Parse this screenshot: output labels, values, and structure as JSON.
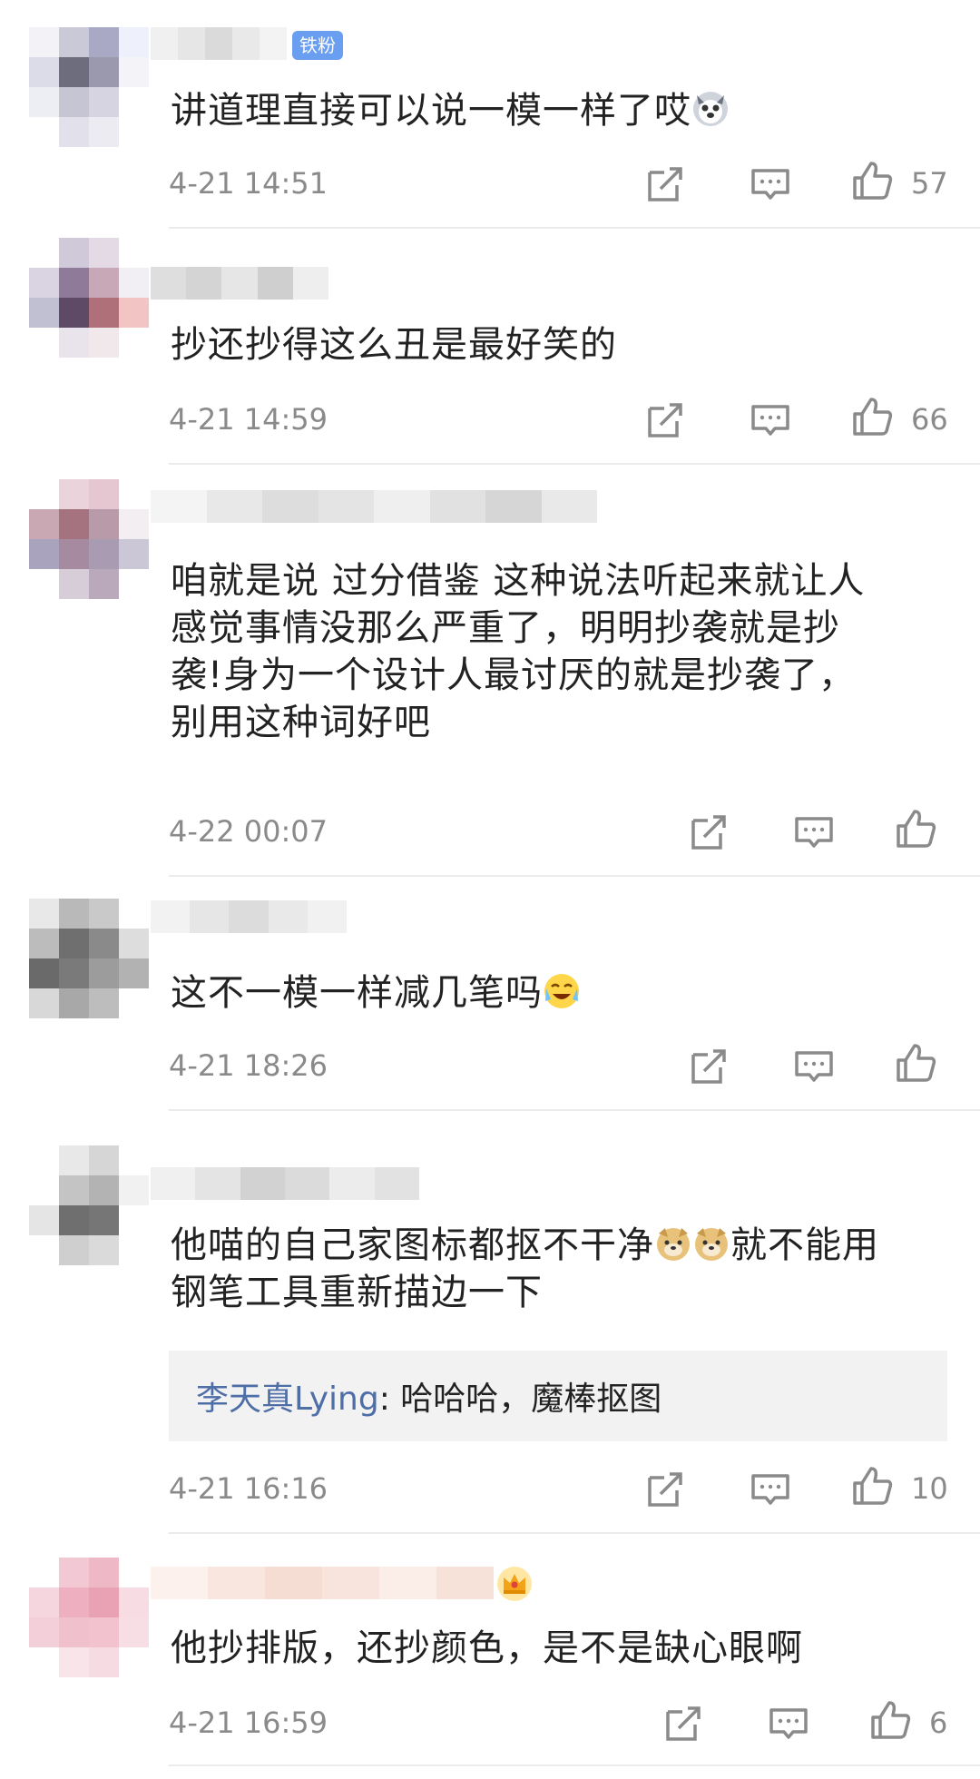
{
  "colors": {
    "background": "#ffffff",
    "text": "#222222",
    "meta": "#8a8a8a",
    "reply_user": "#4e6ea8",
    "badge": "#6a9ef0",
    "divider": "#ebebeb",
    "reply_bg": "#f2f2f2"
  },
  "icons": {
    "share": "share-icon",
    "comment": "comment-icon",
    "like": "thumbs-up-icon"
  },
  "comments": [
    {
      "badge": "铁粉",
      "text": "讲道理直接可以说一模一样了哎",
      "emoji": "husky-face-emoji",
      "time": "4-21 14:51",
      "likes": "57"
    },
    {
      "text": "抄还抄得这么丑是最好笑的",
      "time": "4-21 14:59",
      "likes": "66"
    },
    {
      "text": "咱就是说 过分借鉴 这种说法听起来就让人\n感觉事情没那么严重了，明明抄袭就是抄\n袭!身为一个设计人最讨厌的就是抄袭了，\n别用这种词好吧",
      "time": "4-22 00:07",
      "likes": ""
    },
    {
      "text": "这不一模一样减几笔吗",
      "emoji": "laughing-crying-emoji",
      "time": "4-21 18:26",
      "likes": ""
    },
    {
      "text_line1_part1": "他喵的自己家图标都抠不干净",
      "emoji": "doge-emoji",
      "text_line1_part2": "就不能用",
      "text_line2": "钢笔工具重新描边一下",
      "reply_user": "李天真Lying",
      "reply_text": ": 哈哈哈，魔棒抠图",
      "time": "4-21 16:16",
      "likes": "10"
    },
    {
      "badge_icon": "crown-icon",
      "text": "他抄排版，还抄颜色，是不是缺心眼啊",
      "time": "4-21 16:59",
      "likes": "6"
    }
  ]
}
